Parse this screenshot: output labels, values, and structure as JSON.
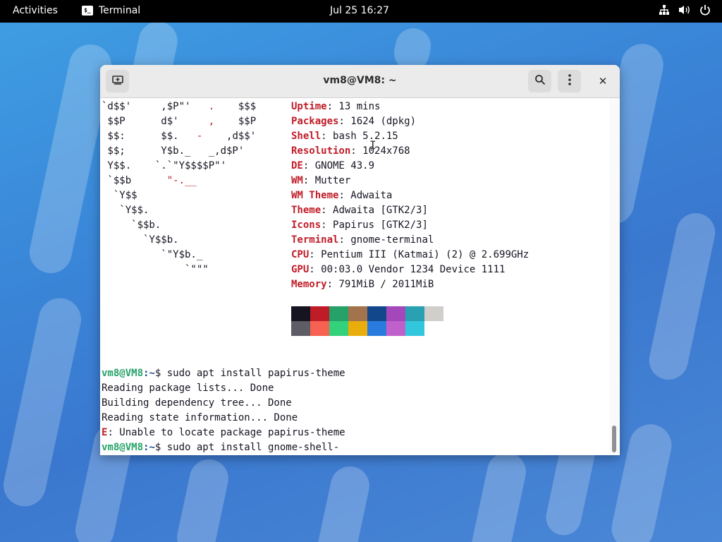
{
  "topbar": {
    "activities": "Activities",
    "app_name": "Terminal",
    "app_icon_glyph": "$_",
    "clock": "Jul 25  16:27"
  },
  "window": {
    "title": "vm8@VM8: ~",
    "close_glyph": "✕"
  },
  "logo": [
    [
      {
        "t": "`d$$'     ,$P\"'   "
      },
      {
        "t": ".",
        "r": true
      },
      {
        "t": "    $$$"
      }
    ],
    [
      {
        "t": " $$P      d$'     "
      },
      {
        "t": ",",
        "r": true
      },
      {
        "t": "    $$P"
      }
    ],
    [
      {
        "t": " $$:      $$.   "
      },
      {
        "t": "-",
        "r": true
      },
      {
        "t": "    ,d$$'"
      }
    ],
    [
      {
        "t": " $$;      Y$b._   _,d$P'"
      }
    ],
    [
      {
        "t": " Y$$.    `.`\"Y$$$$P\"'"
      }
    ],
    [
      {
        "t": " `$$b      "
      },
      {
        "t": "\"-.__",
        "r": true
      }
    ],
    [
      {
        "t": "  `Y$$"
      }
    ],
    [
      {
        "t": "   `Y$$."
      }
    ],
    [
      {
        "t": "     `$$b."
      }
    ],
    [
      {
        "t": "       `Y$$b."
      }
    ],
    [
      {
        "t": "          `\"Y$b._"
      }
    ],
    [
      {
        "t": "              `\"\"\""
      }
    ]
  ],
  "info": [
    {
      "key": "Uptime",
      "value": ": 13 mins"
    },
    {
      "key": "Packages",
      "value": ": 1624 (dpkg)"
    },
    {
      "key": "Shell",
      "value": ": bash 5.2.15"
    },
    {
      "key": "Resolution",
      "value": ": 1024x768"
    },
    {
      "key": "DE",
      "value": ": GNOME 43.9"
    },
    {
      "key": "WM",
      "value": ": Mutter"
    },
    {
      "key": "WM Theme",
      "value": ": Adwaita"
    },
    {
      "key": "Theme",
      "value": ": Adwaita [GTK2/3]"
    },
    {
      "key": "Icons",
      "value": ": Papirus [GTK2/3]"
    },
    {
      "key": "Terminal",
      "value": ": gnome-terminal"
    },
    {
      "key": "CPU",
      "value": ": Pentium III (Katmai) (2) @ 2.699GHz"
    },
    {
      "key": "GPU",
      "value": ": 00:03.0 Vendor 1234 Device 1111"
    },
    {
      "key": "Memory",
      "value": ": 791MiB / 2011MiB"
    }
  ],
  "palette": {
    "row1": [
      "#171421",
      "#c01c28",
      "#26a269",
      "#a2734c",
      "#12488b",
      "#a347ba",
      "#2aa1b3",
      "#d0cfcc"
    ],
    "row2": [
      "#5e5c64",
      "#f66151",
      "#33d17a",
      "#e9ad0c",
      "#2a7bde",
      "#c061cb",
      "#33c7de"
    ]
  },
  "output": {
    "prompt_user": "vm8@VM8",
    "prompt_path": ":~",
    "prompt_symbol": "$ ",
    "cmd1": "sudo apt install papirus-theme",
    "out1": "Reading package lists... Done",
    "out2": "Building dependency tree... Done",
    "out3": "Reading state information... Done",
    "err_label": "E",
    "err_text": ": Unable to locate package papirus-theme",
    "cmd2": "sudo apt install gnome-shell-"
  },
  "colors": {
    "red": "#c01c28",
    "green": "#26a269",
    "blue": "#12488b"
  }
}
